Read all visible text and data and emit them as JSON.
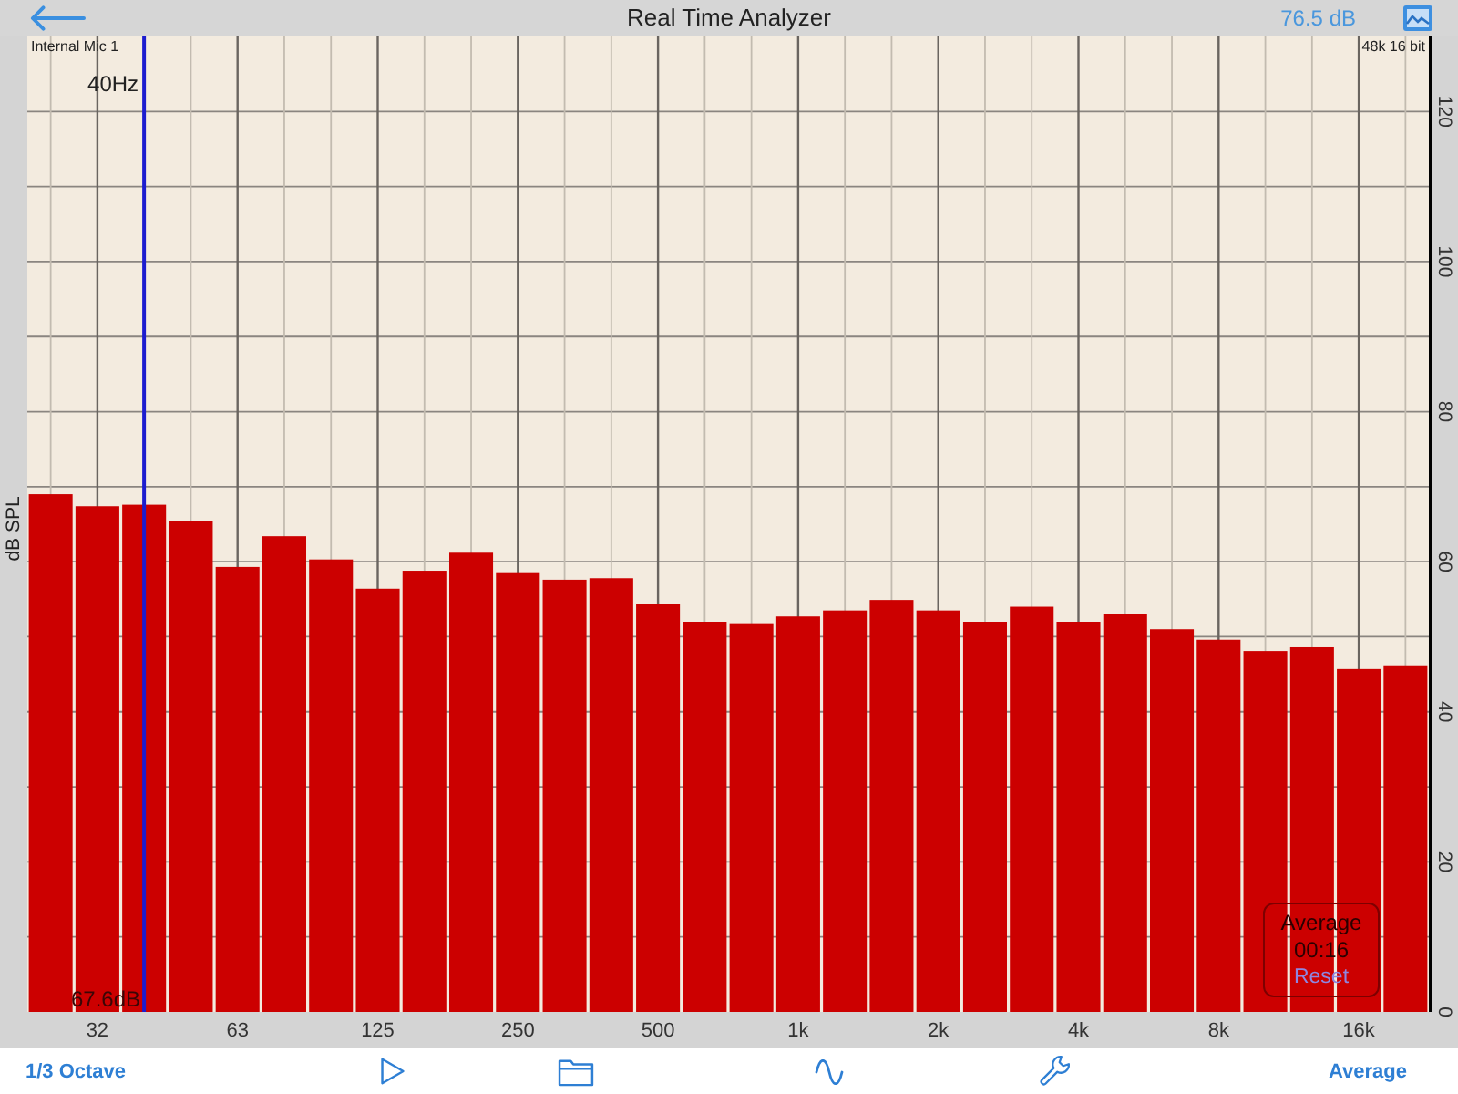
{
  "header": {
    "title": "Real Time Analyzer",
    "level_reading": "76.5 dB"
  },
  "analyzer": {
    "input": "Internal Mic 1",
    "format": "48k 16 bit",
    "cursor": {
      "frequency": "40Hz",
      "reading": "67.6dB",
      "level": 0.0833
    },
    "chart_data": {
      "type": "bar",
      "ylabel": "dB SPL",
      "categories": [
        null,
        "32",
        null,
        null,
        "63",
        null,
        null,
        "125",
        null,
        null,
        "250",
        null,
        null,
        "500",
        null,
        null,
        "1k",
        null,
        null,
        "2k",
        null,
        null,
        "4k",
        null,
        null,
        "8k",
        null,
        null,
        "16k",
        null
      ],
      "series": [
        {
          "color": "#cc0000",
          "values": [
            69.0,
            67.4,
            67.6,
            65.4,
            59.3,
            63.4,
            60.3,
            56.4,
            58.8,
            61.2,
            58.6,
            57.6,
            57.8,
            54.4,
            52.0,
            51.8,
            52.7,
            53.5,
            54.9,
            53.5,
            52.0,
            54.0,
            52.0,
            53.0,
            51.0,
            49.6,
            48.1,
            48.6,
            45.7,
            46.2
          ]
        }
      ],
      "ylim": [
        0,
        130
      ],
      "yticks": [
        0,
        20,
        40,
        60,
        80,
        100,
        120
      ],
      "grid": true
    },
    "average_panel": {
      "title": "Average",
      "elapsed": "00:16",
      "reset": "Reset"
    }
  },
  "toolbar": [
    {
      "kind": "text",
      "label": "1/3 Octave"
    },
    {
      "kind": "play"
    },
    {
      "kind": "folder"
    },
    {
      "kind": "wave"
    },
    {
      "kind": "wrench"
    },
    {
      "kind": "text",
      "label": "Average"
    }
  ]
}
